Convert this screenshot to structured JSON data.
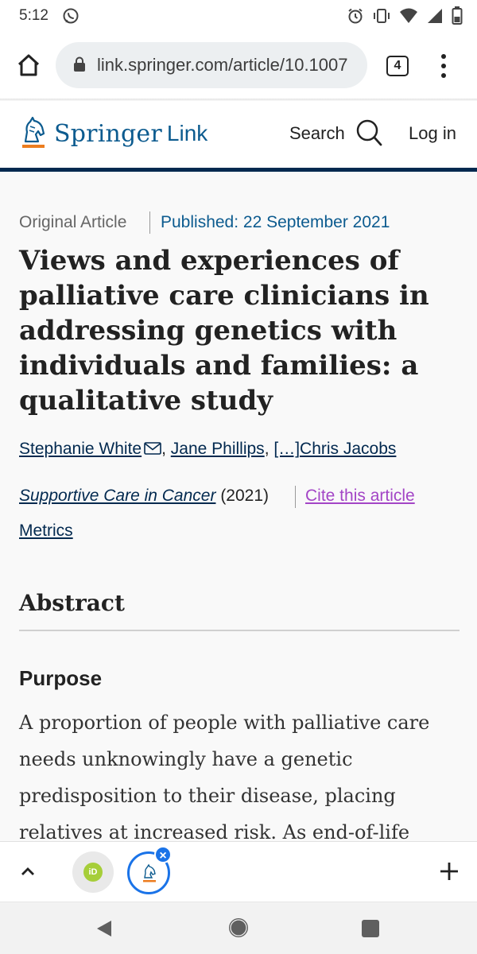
{
  "status_bar": {
    "time": "5:12"
  },
  "browser": {
    "url": "link.springer.com/article/10.1007",
    "tab_count": "4"
  },
  "site": {
    "logo_springer": "Springer",
    "logo_link": "Link",
    "search_label": "Search",
    "login_label": "Log in",
    "brand_color": "#0c5b8f",
    "header_rule_color": "#02294f"
  },
  "article": {
    "type": "Original Article",
    "published": "Published: 22 September 2021",
    "title": "Views and experiences of palliative care clinicians in addressing genetics with individuals and families: a qualitative study",
    "authors": {
      "first": "Stephanie White",
      "second": "Jane Phillips",
      "ellipsis": "[…]",
      "last": "Chris Jacobs"
    },
    "journal": "Supportive Care in Cancer",
    "year": "(2021)",
    "cite_label": "Cite this article",
    "metrics_label": "Metrics"
  },
  "abstract": {
    "heading": "Abstract",
    "purpose_heading": "Purpose",
    "purpose_text": "A proportion of people with palliative care needs unknowingly have a genetic predisposition to their disease, placing relatives at increased risk. As end-of-life"
  },
  "bottom_toolbar": {
    "orcid_badge": "iD"
  },
  "icons": {
    "whatsapp": "whatsapp-icon",
    "alarm": "alarm-icon",
    "vibrate": "vibrate-icon",
    "wifi": "wifi-icon",
    "signal": "signal-icon",
    "battery": "battery-icon",
    "home": "home-icon",
    "lock": "lock-icon",
    "menu": "more-vert-icon",
    "search": "search-icon",
    "mail": "mail-icon",
    "up": "chevron-up-icon",
    "plus": "plus-icon",
    "close": "close-icon"
  }
}
